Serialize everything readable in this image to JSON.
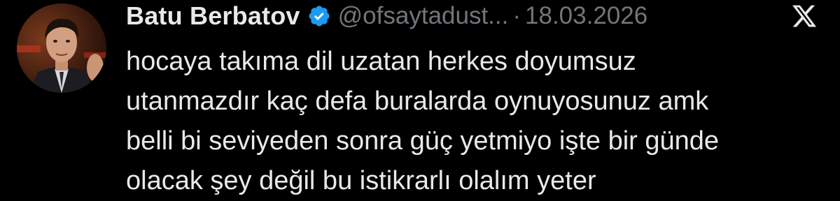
{
  "author": {
    "display_name": "Batu Berbatov",
    "handle": "@ofsaytadust...",
    "separator": "·",
    "date": "18.03.2026",
    "verified": true,
    "verified_badge_color": "#1d9bf0",
    "avatar_icon": "profile-photo"
  },
  "brand": {
    "logo_icon": "x-logo-icon",
    "logo_color": "#e7e9ea"
  },
  "tweet": {
    "lines": [
      "hocaya takıma dil uzatan herkes doyumsuz",
      "utanmazdır kaç defa buralarda oynuyosunuz amk",
      "belli bi seviyeden sonra güç yetmiyo işte bir günde",
      "olacak şey değil bu istikrarlı olalım yeter"
    ]
  },
  "colors": {
    "background": "#000000",
    "primary_text": "#e7e9ea",
    "secondary_text": "#71767b"
  }
}
